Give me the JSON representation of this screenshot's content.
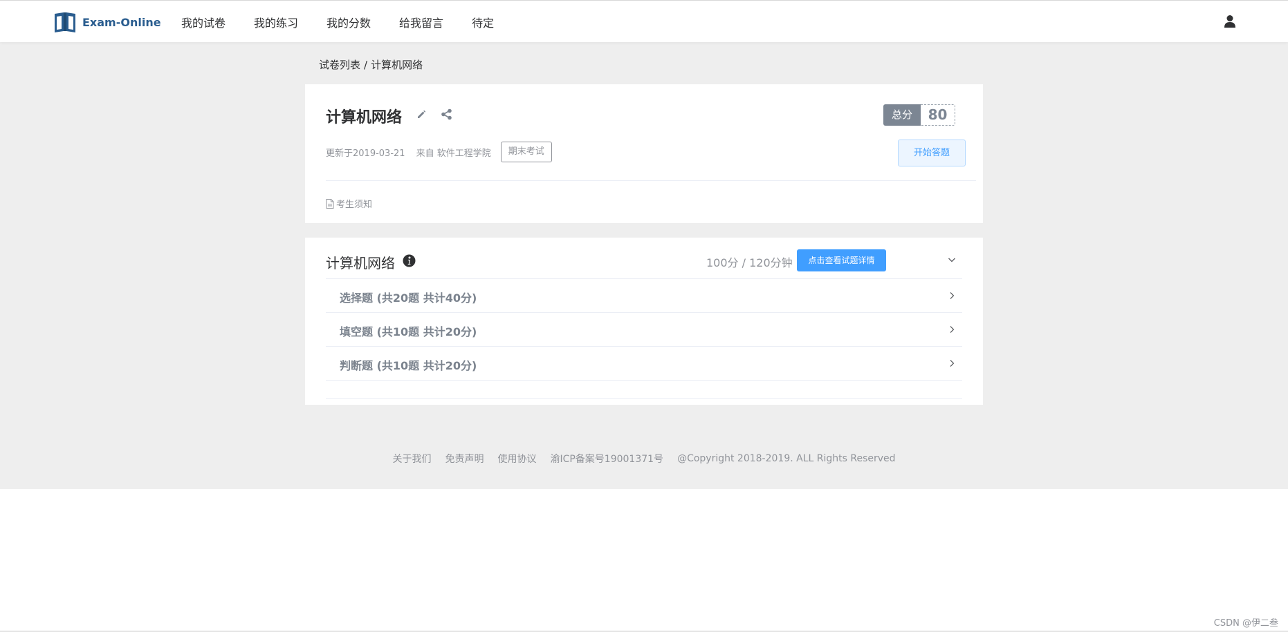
{
  "header": {
    "logo_text": "Exam-Online",
    "nav": [
      "我的试卷",
      "我的练习",
      "我的分数",
      "给我留言",
      "待定"
    ]
  },
  "breadcrumb": {
    "parent": "试卷列表",
    "separator": "/",
    "current": "计算机网络"
  },
  "paper": {
    "title": "计算机网络",
    "total_label": "总分",
    "total_score": "80",
    "updated": "更新于2019-03-21",
    "from": "来自 软件工程学院",
    "tag": "期末考试",
    "start_button": "开始答题",
    "notice": "考生须知"
  },
  "section": {
    "title": "计算机网络",
    "summary": "100分 / 120分钟",
    "detail_button": "点击查看试题详情",
    "questions": [
      "选择题 (共20题 共计40分)",
      "填空题 (共10题 共计20分)",
      "判断题 (共10题 共计20分)"
    ]
  },
  "footer": {
    "links": [
      "关于我们",
      "免责声明",
      "使用协议",
      "渝ICP备案号19001371号"
    ],
    "copyright": "@Copyright 2018-2019. ALL Rights Reserved"
  },
  "watermark": "CSDN @伊二叁",
  "colors": {
    "brand": "#2a5d8f",
    "primary": "#409eff",
    "background": "#eeeeee"
  }
}
